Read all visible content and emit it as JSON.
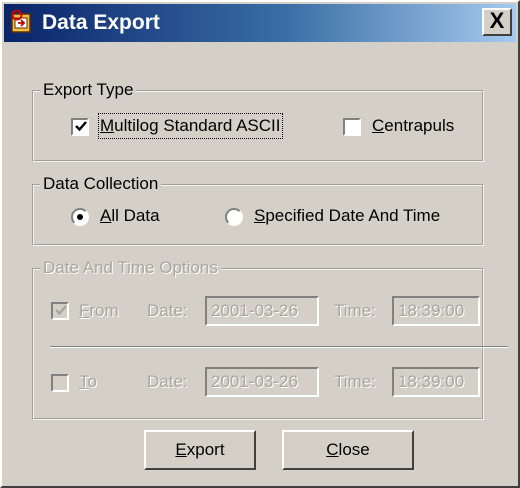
{
  "window": {
    "title": "Data Export",
    "app_icon": "export-icon",
    "close_icon": "close-icon",
    "close_label": "X"
  },
  "export_type": {
    "legend": "Export Type",
    "multilog": {
      "label": "Multilog Standard ASCII",
      "mnemonic": "M",
      "rest": "ultilog Standard ASCII",
      "checked": true
    },
    "centrapuls": {
      "label": "Centrapuls",
      "mnemonic": "C",
      "rest": "entrapuls",
      "checked": false
    }
  },
  "data_collection": {
    "legend": "Data Collection",
    "all_data": {
      "label": "All Data",
      "mnemonic": "A",
      "rest": "ll Data",
      "selected": true
    },
    "specified": {
      "label": "Specified Date And Time",
      "mnemonic": "S",
      "rest": "pecified Date And Time",
      "selected": false
    }
  },
  "date_time_options": {
    "legend": "Date And Time Options",
    "enabled": false,
    "from": {
      "label": "From",
      "mnemonic": "F",
      "rest": "rom",
      "checked": true,
      "date_label": "Date:",
      "date": "2001-03-26",
      "time_label": "Time:",
      "time": "18:39:00"
    },
    "to": {
      "label": "To",
      "mnemonic": "T",
      "rest": "o",
      "checked": false,
      "date_label": "Date:",
      "date": "2001-03-26",
      "time_label": "Time:",
      "time": "18:39:00"
    }
  },
  "buttons": {
    "export": {
      "label": "Export",
      "mnemonic": "E",
      "rest": "xport"
    },
    "close": {
      "label": "Close",
      "mnemonic": "C",
      "rest": "lose"
    }
  },
  "colors": {
    "face": "#d4d0c8",
    "title_start": "#0a246a",
    "title_end": "#a6caf0",
    "disabled_text": "#a9a69e"
  }
}
